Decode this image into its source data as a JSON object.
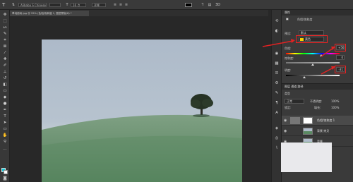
{
  "option_bar": {
    "font_family": "Alibaba S Chinese",
    "font_size": "16 点",
    "anti_alias": "浑厚"
  },
  "document": {
    "tab_title": "草地孤树.jpg @ 25% (色相/饱和度 1, 图层蒙版/8) *"
  },
  "properties_panel": {
    "header": "属性",
    "title": "色相/饱和度",
    "preset_label": "预设:",
    "preset_value": "默认",
    "channel_label": "",
    "channel_value": "黄色",
    "hue_label": "色相:",
    "hue_value": "+56",
    "saturation_label": "饱和度:",
    "saturation_value": "0",
    "lightness_label": "明度:",
    "lightness_value": "-31"
  },
  "layers_panel": {
    "tabs": "图层   通道   路径",
    "kind": "类型",
    "blend_mode": "正常",
    "opacity_label": "不透明度:",
    "opacity_value": "100%",
    "lock_label": "锁定:",
    "fill_label": "填充:",
    "fill_value": "100%",
    "layers": [
      {
        "name": "色相/饱和度 1"
      },
      {
        "name": "背景 拷贝"
      },
      {
        "name": "背景"
      }
    ]
  },
  "colors": {
    "foreground": "#16c9d9",
    "background": "#ffffff",
    "accent_red": "#e22222"
  }
}
